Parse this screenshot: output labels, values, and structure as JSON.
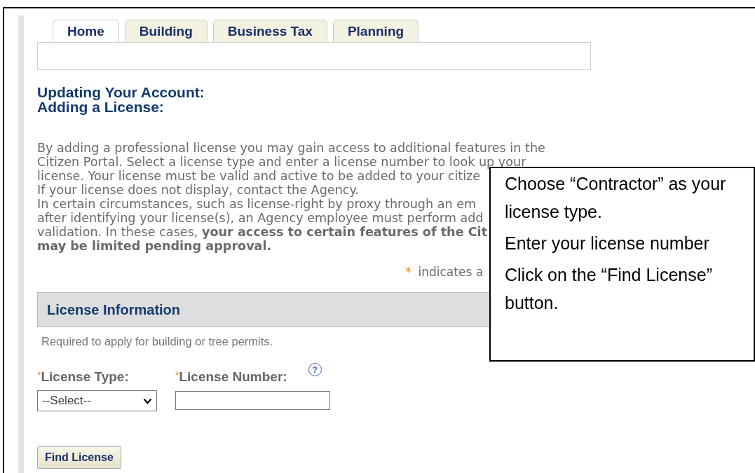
{
  "tabs": [
    {
      "label": "Home",
      "selected": true
    },
    {
      "label": "Building",
      "selected": false
    },
    {
      "label": "Business Tax",
      "selected": false
    },
    {
      "label": "Planning",
      "selected": false
    }
  ],
  "heading": [
    "Updating Your Account:",
    "Adding a License:"
  ],
  "intro": {
    "lines": [
      "By adding a professional license you may gain access to additional features in the",
      "Citizen Portal. Select a license type and enter a license number to look up your",
      "license. Your license must be valid and active to be added to your citize",
      "If your license does not display, contact the Agency.",
      "In certain circumstances, such as license-right by proxy through an em",
      "after identifying your license(s), an Agency employee must perform add",
      "validation. In these cases, **your access to certain features of the Cit**",
      "**may be limited pending approval.**"
    ]
  },
  "required_note": {
    "marker": "*",
    "text": "indicates a"
  },
  "section": {
    "title": "License Information",
    "description": "Required to apply for building or tree permits.",
    "fields": [
      {
        "kind": "select",
        "marker": "*",
        "label": "License Type:",
        "value": "--Select--"
      },
      {
        "kind": "text",
        "marker": "*",
        "label": "License Number:",
        "help": "?"
      }
    ]
  },
  "button": "Find License",
  "callout": [
    "Choose “Contractor” as your license type.",
    "Enter your license number",
    "Click on the “Find License” button."
  ]
}
